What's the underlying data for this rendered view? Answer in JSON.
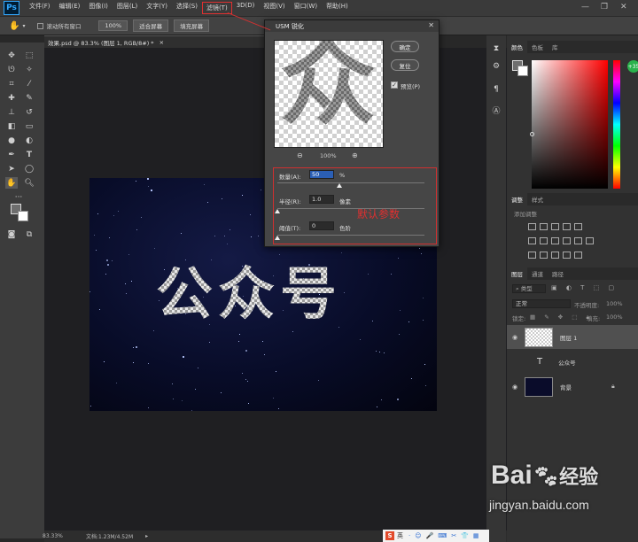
{
  "app": {
    "logo": "Ps",
    "menu": [
      "文件(F)",
      "编辑(E)",
      "图像(I)",
      "图层(L)",
      "文字(Y)",
      "选择(S)",
      "滤镜(T)",
      "3D(D)",
      "视图(V)",
      "窗口(W)",
      "帮助(H)"
    ],
    "active_menu_index": 6
  },
  "options": {
    "scroll_all_label": "滚动所有窗口",
    "zoom_value": "100%",
    "fit_screen": "适合屏幕",
    "fill_screen": "填充屏幕"
  },
  "document": {
    "tab_title": "效果.psd @ 83.3% (图层 1, RGB/8#) *",
    "canvas_text": "公众号",
    "status_zoom": "83.33%",
    "status_doc": "文档:1.23M/4.52M"
  },
  "dialog": {
    "title": "USM 锐化",
    "ok_label": "确定",
    "reset_label": "复位",
    "preview_label": "预览(P)",
    "preview_checked": true,
    "preview_glyph": "众",
    "zoom_value": "100%",
    "amount_label": "数量(A):",
    "amount_value": "50",
    "amount_unit": "%",
    "amount_fraction": 0.1,
    "radius_label": "半径(R):",
    "radius_value": "1.0",
    "radius_unit": "像素",
    "radius_fraction": 0.0,
    "threshold_label": "阈值(T):",
    "threshold_value": "0",
    "threshold_unit": "色阶",
    "threshold_fraction": 0.0,
    "annotation": "默认参数"
  },
  "panels": {
    "color_tabs": [
      "颜色",
      "色板",
      "库"
    ],
    "adjust_tabs": [
      "调整",
      "样式"
    ],
    "adjust_title": "添加调整",
    "layer_tabs": [
      "图层",
      "通道",
      "路径"
    ],
    "kind_filter": "类型",
    "blend_mode": "正常",
    "opacity_label": "不透明度:",
    "opacity_value": "100%",
    "lock_label": "锁定:",
    "fill_label": "填充:",
    "fill_value": "100%",
    "layers": [
      {
        "name": "图层 1",
        "kind": "pixel",
        "selected": true
      },
      {
        "name": "公众号",
        "kind": "text",
        "selected": false
      },
      {
        "name": "背景",
        "kind": "background",
        "selected": false
      }
    ],
    "badge": "+35"
  },
  "watermark": {
    "brand": "Bai",
    "brand_suffix": "经验",
    "url": "jingyan.baidu.com"
  },
  "taskbar": {
    "ime_label": "英"
  }
}
